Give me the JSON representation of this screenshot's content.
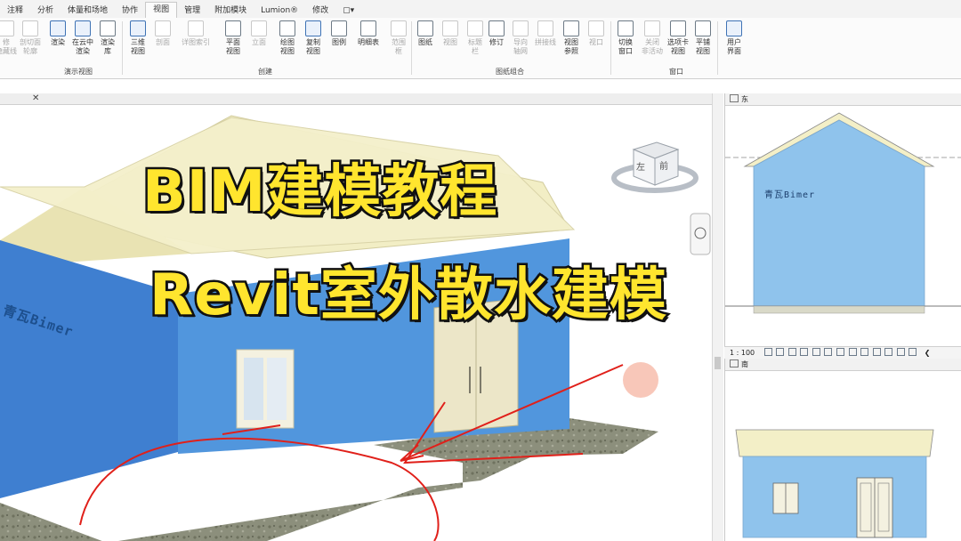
{
  "ribbon_tabs": {
    "items": [
      "注释",
      "分析",
      "体量和场地",
      "协作",
      "视图",
      "管理",
      "附加模块",
      "Lumion®",
      "修改",
      "▢▾"
    ],
    "active": "视图"
  },
  "ribbon_buttons": {
    "b0": "修\n隐藏线",
    "b1": "剖切面\n轮廓",
    "b2": "渲染",
    "b3": "在云中\n渲染",
    "b4": "渲染\n库",
    "b5": "三维\n视图",
    "b6": "剖面",
    "b7": "详图索引",
    "b8": "平面\n视图",
    "b9": "立面",
    "b10": "绘图\n视图",
    "b11": "复制\n视图",
    "b12": "图例",
    "b13": "明细表",
    "b14": "范围\n框",
    "b15": "图纸",
    "b16": "视图",
    "b17": "标题\n栏",
    "b18": "修订",
    "b19": "导向\n轴网",
    "b20": "拼接线",
    "b21": "视图\n参照",
    "b22": "视口",
    "b23": "切换\n窗口",
    "b24": "关闭\n非活动",
    "b25": "选项卡\n视图",
    "b26": "平铺\n视图",
    "b27": "用户\n界面"
  },
  "ribbon_groups": {
    "presentation": "演示视图",
    "create": "创建",
    "sheet": "图纸组合",
    "window": "窗口"
  },
  "overlay": {
    "line1": "BIM建模教程",
    "line2": "Revit室外散水建模"
  },
  "model": {
    "watermark_3d": "青瓦Bimer",
    "viewcube_left": "左",
    "viewcube_front": "前"
  },
  "elevation_east": {
    "title": "东",
    "watermark": "青瓦Bimer"
  },
  "view_status": {
    "scale": "1 : 100"
  },
  "elevation_south": {
    "title": "南"
  },
  "colors": {
    "wall_blue": "#4f90d6",
    "elevation_blue": "#8fc3ec",
    "roof": "#f3efc7",
    "title_yellow": "#ffe52e",
    "ink_red": "#e0201a"
  }
}
